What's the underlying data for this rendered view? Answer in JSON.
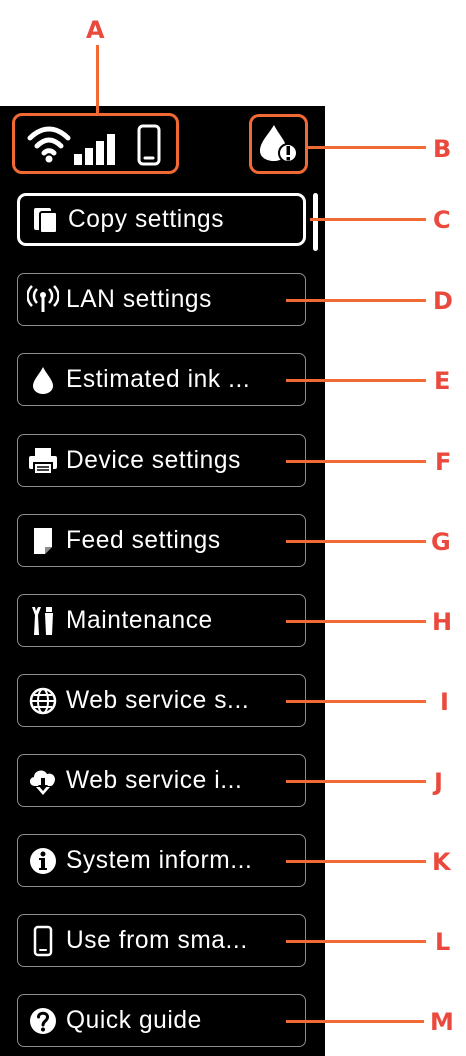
{
  "menu": {
    "items": [
      {
        "label": "Copy settings",
        "icon": "copy-icon",
        "callout": "C",
        "selected": true
      },
      {
        "label": "LAN settings",
        "icon": "wireless-antenna-icon",
        "callout": "D"
      },
      {
        "label": "Estimated ink ...",
        "icon": "ink-drop-icon",
        "callout": "E"
      },
      {
        "label": "Device settings",
        "icon": "printer-icon",
        "callout": "F"
      },
      {
        "label": "Feed settings",
        "icon": "paper-icon",
        "callout": "G"
      },
      {
        "label": "Maintenance",
        "icon": "tools-icon",
        "callout": "H"
      },
      {
        "label": "Web service s...",
        "icon": "globe-icon",
        "callout": "I"
      },
      {
        "label": "Web service i...",
        "icon": "cloud-download-icon",
        "callout": "J"
      },
      {
        "label": "System inform...",
        "icon": "info-icon",
        "callout": "K"
      },
      {
        "label": "Use from sma...",
        "icon": "smartphone-icon",
        "callout": "L"
      },
      {
        "label": "Quick guide",
        "icon": "help-icon",
        "callout": "M"
      }
    ]
  },
  "status": {
    "network_callout": "A",
    "ink_callout": "B",
    "icons": [
      "wifi-icon",
      "signal-strength-icon",
      "smartphone-icon",
      "ink-warning-icon"
    ]
  },
  "colors": {
    "screen": "#000000",
    "menu_border": "#8d8d8d",
    "selected_border": "#ffffff",
    "callout": "#ea4a3d",
    "callout_line": "#f26a33"
  }
}
